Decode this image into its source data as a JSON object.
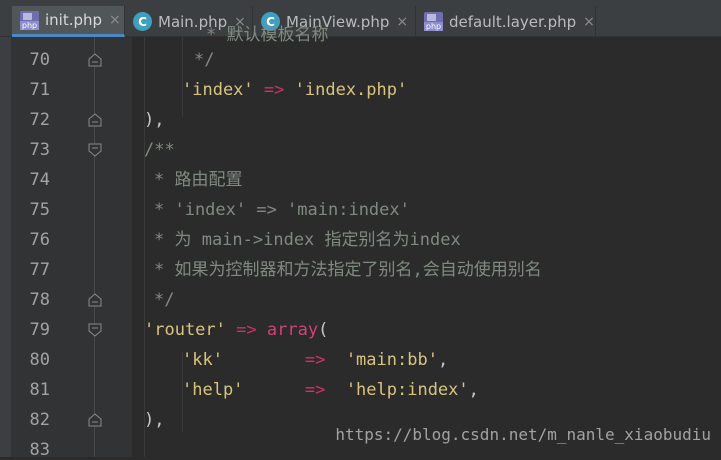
{
  "tabs": [
    {
      "label": "init.php",
      "icon": "php-file-icon",
      "active": true
    },
    {
      "label": "Main.php",
      "icon": "class-icon",
      "active": false
    },
    {
      "label": "MainView.php",
      "icon": "class-icon",
      "active": false
    },
    {
      "label": "default.layer.php",
      "icon": "php-file-icon",
      "active": false
    }
  ],
  "close_glyph": "×",
  "php_badge": "php",
  "class_glyph": "C",
  "line_numbers": [
    "70",
    "71",
    "72",
    "73",
    "74",
    "75",
    "76",
    "77",
    "78",
    "79",
    "80",
    "81",
    "82",
    "83"
  ],
  "code": {
    "l69_partial": "* 默认模板名称",
    "l70": "*/",
    "l71_key": "'index'",
    "l71_arrow": "=>",
    "l71_val": "'index.php'",
    "l72": "),",
    "l73": "/**",
    "l74": "* 路由配置",
    "l75": "* 'index' => 'main:index'",
    "l76": "* 为 main->index 指定别名为index",
    "l77": "* 如果为控制器和方法指定了别名,会自动使用别名",
    "l78": "*/",
    "l79_key": "'router'",
    "l79_arrow": "=>",
    "l79_fn": "array",
    "l79_paren": "(",
    "l80_key": "'kk'",
    "l80_arrow": "=>",
    "l80_val": "'main:bb'",
    "l80_comma": ",",
    "l81_key": "'help'",
    "l81_arrow": "=>",
    "l81_val": "'help:index'",
    "l81_comma": ",",
    "l82": "),"
  },
  "watermark": "https://blog.csdn.net/m_nanle_xiaobudiu",
  "colors": {
    "background": "#2b2b2b",
    "string": "#d9c47f",
    "operator": "#cc3366",
    "comment": "#808a80",
    "active_tab_underline": "#4a88c7"
  }
}
